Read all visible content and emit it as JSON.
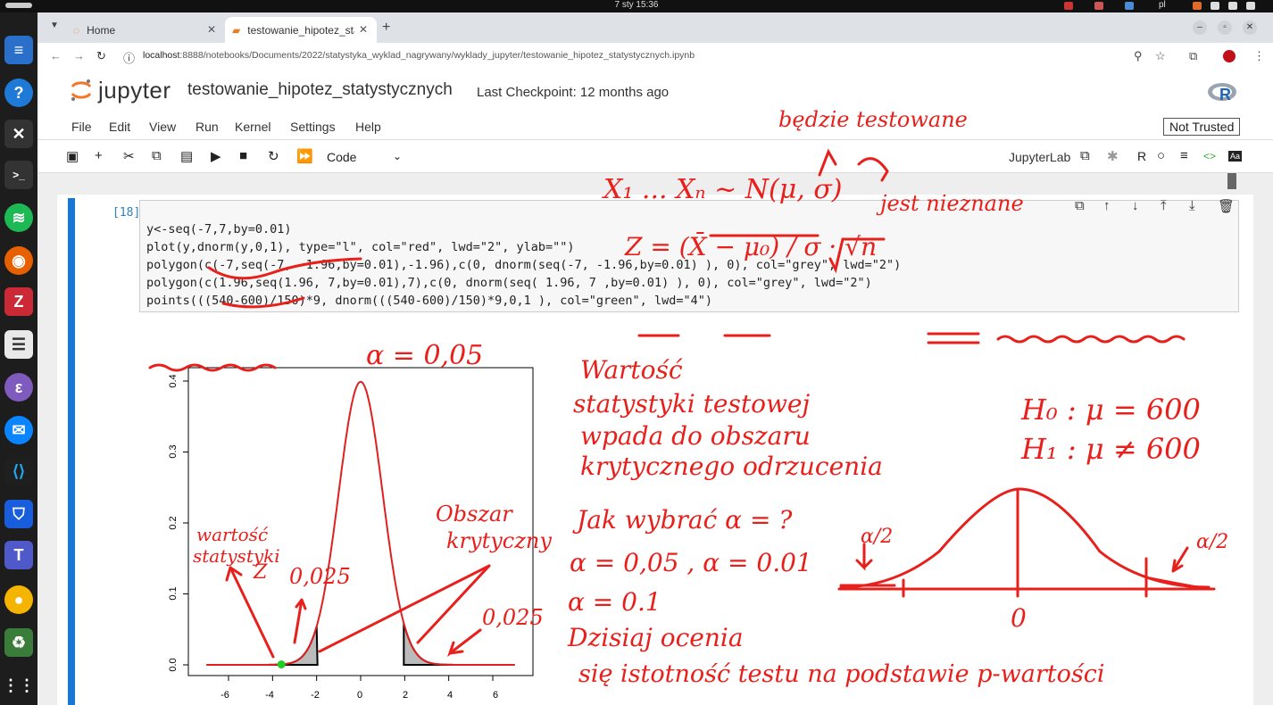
{
  "system": {
    "clock": "7 sty  15:36",
    "lang": "pl"
  },
  "browser": {
    "tabs": [
      {
        "label": "Home"
      },
      {
        "label": "testowanie_hipotez_sta"
      }
    ],
    "url_host": "localhost",
    "url_path": ":8888/notebooks/Documents/2022/statystyka_wyklad_nagrywany/wyklady_jupyter/testowanie_hipotez_statystycznych.ipynb"
  },
  "jupyter": {
    "logo_text": "jupyter",
    "notebook_name": "testowanie_hipotez_statystycznych",
    "checkpoint": "Last Checkpoint: 12 months ago",
    "menu": [
      "File",
      "Edit",
      "View",
      "Run",
      "Kernel",
      "Settings",
      "Help"
    ],
    "trust": "Not Trusted",
    "cell_type": "Code",
    "jupyterlab_label": "JupyterLab",
    "kernel_label": "R",
    "icons": {
      "save": "save-icon",
      "add": "plus-icon",
      "cut": "scissors-icon",
      "copy": "copy-icon",
      "paste": "paste-icon",
      "run": "play-icon",
      "stop": "stop-icon",
      "restart": "restart-icon",
      "run_all": "fast-forward-icon"
    }
  },
  "cell": {
    "prompt": "[18]:",
    "code": [
      "y<-seq(-7,7,by=0.01)",
      "plot(y,dnorm(y,0,1), type=\"l\", col=\"red\", lwd=\"2\", ylab=\"\")",
      "polygon(c(-7,seq(-7, -1.96,by=0.01),-1.96),c(0, dnorm(seq(-7, -1.96,by=0.01) ), 0), col=\"grey\", lwd=\"2\")",
      "polygon(c(1.96,seq(1.96, 7,by=0.01),7),c(0, dnorm(seq( 1.96, 7 ,by=0.01) ), 0), col=\"grey\", lwd=\"2\")",
      "points(((540-600)/150)*9, dnorm(((540-600)/150)*9,0,1 ), col=\"green\", lwd=\"4\")"
    ]
  },
  "plot": {
    "x_ticks": [
      "-6",
      "-4",
      "-2",
      "0",
      "2",
      "4",
      "6"
    ],
    "y_ticks": [
      "0.0",
      "0.1",
      "0.2",
      "0.3",
      "0.4"
    ],
    "point_x": -3.6
  },
  "annotations": {
    "alpha": "α = 0,05",
    "tested": "będzie testowane",
    "sample": "X₁ ... Xₙ ~ N(μ, σ)",
    "unknown": "jest nieznane",
    "z_stat": "Z = (X̄ − μ₀) / σ · √n",
    "value_text": [
      "Wartość",
      "statystyki testowej",
      "wpada do obszaru",
      "krytycznego odrzucenia"
    ],
    "how_alpha": "Jak wybrać α = ?",
    "alpha_vals": "α = 0,05 , α = 0.01",
    "alpha_01": "α = 0.1",
    "today": "Dzisiaj ocenia",
    "pvalue": "się istotność testu na podstawie p-wartości",
    "h0": "H₀ : μ = 600",
    "h1": "H₁ : μ ≠ 600",
    "half_alpha": "α/2",
    "zero": "0",
    "critical_region": [
      "Obszar",
      "krytyczny"
    ],
    "stat_value": [
      "wartość",
      "statystyki",
      "Z"
    ],
    "p025_a": "0,025",
    "p025_b": "0,025"
  },
  "colors": {
    "ink": "#e8201c",
    "cell_accent": "#1976d2",
    "prompt": "#307fc1"
  }
}
